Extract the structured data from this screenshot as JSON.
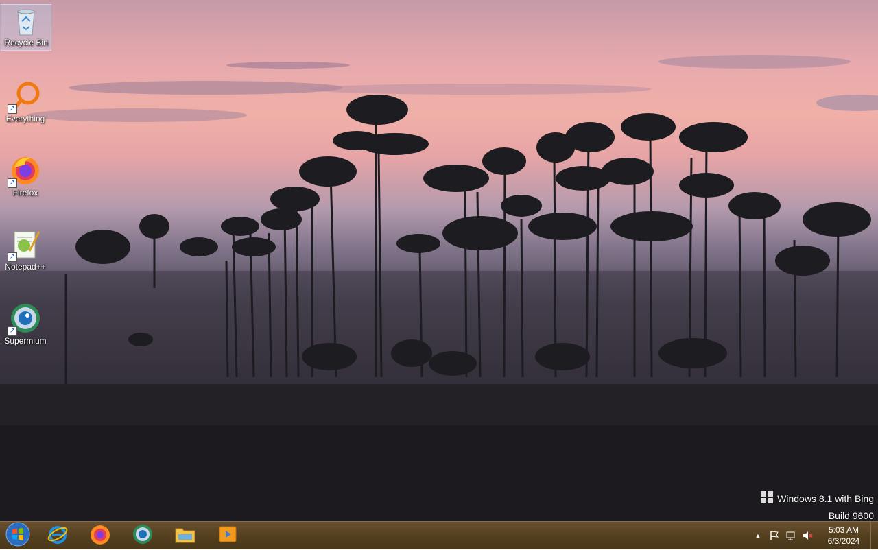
{
  "desktop": {
    "icons": [
      {
        "label": "Recycle Bin",
        "icon": "recycle-bin-icon"
      },
      {
        "label": "Everything",
        "icon": "everything-search-icon"
      },
      {
        "label": "Firefox",
        "icon": "firefox-icon"
      },
      {
        "label": "Notepad++",
        "icon": "notepad-plus-plus-icon"
      },
      {
        "label": "Supermium",
        "icon": "supermium-icon"
      }
    ]
  },
  "watermark": {
    "line1": "Windows 8.1 with Bing",
    "line2": "Build 9600"
  },
  "taskbar": {
    "pinned": [
      {
        "name": "start",
        "icon": "windows-start-icon"
      },
      {
        "name": "internet-explorer",
        "icon": "internet-explorer-icon"
      },
      {
        "name": "firefox",
        "icon": "firefox-icon"
      },
      {
        "name": "supermium",
        "icon": "supermium-icon"
      },
      {
        "name": "file-explorer",
        "icon": "file-explorer-icon"
      },
      {
        "name": "media-player",
        "icon": "media-player-icon"
      }
    ],
    "tray": {
      "show_hidden": "▲",
      "time": "5:03 AM",
      "date": "6/3/2024"
    }
  },
  "colors": {
    "taskbar": "#54401f",
    "sky_pink": "#f0b0a8",
    "ground": "#1f1d22"
  }
}
